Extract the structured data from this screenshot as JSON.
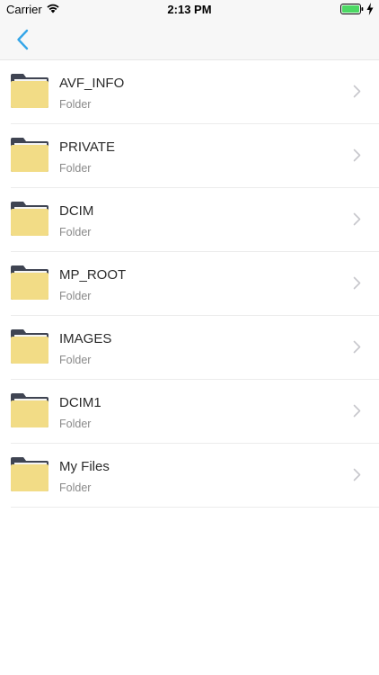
{
  "status_bar": {
    "carrier": "Carrier",
    "time": "2:13 PM",
    "battery_color": "#4cd964"
  },
  "nav": {
    "title": "",
    "back_icon": "chevron-left-icon",
    "accent_color": "#35a6e8"
  },
  "folders": [
    {
      "name": "AVF_INFO",
      "type": "Folder"
    },
    {
      "name": "PRIVATE",
      "type": "Folder"
    },
    {
      "name": "DCIM",
      "type": "Folder"
    },
    {
      "name": "MP_ROOT",
      "type": "Folder"
    },
    {
      "name": "IMAGES",
      "type": "Folder"
    },
    {
      "name": "DCIM1",
      "type": "Folder"
    },
    {
      "name": "My Files",
      "type": "Folder"
    }
  ],
  "colors": {
    "folder_body": "#f2dc86",
    "folder_back": "#3f4452",
    "folder_paper": "#f4f4f4"
  }
}
